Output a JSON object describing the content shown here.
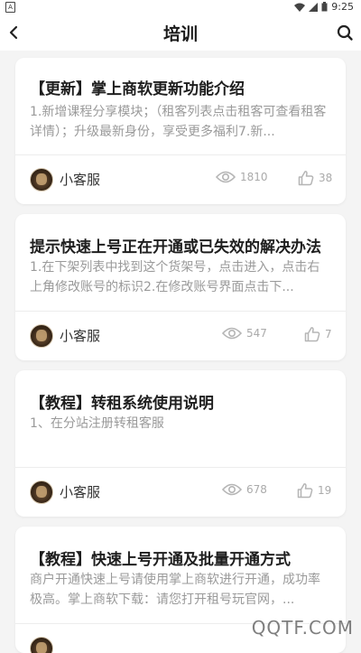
{
  "status_bar": {
    "left_glyph": "A",
    "time": "9:25"
  },
  "header": {
    "title": "培训"
  },
  "articles": [
    {
      "title": "【更新】掌上商软更新功能介绍",
      "desc": "1.新增课程分享模块；（租客列表点击租客可查看租客详情）；升级最新身份，享受更多福利7.新...",
      "author": "小客服",
      "views": "1810",
      "likes": "38"
    },
    {
      "title": "提示快速上号正在开通或已失效的解决办法",
      "desc": "1.在下架列表中找到这个货架号，点击进入，点击右上角修改账号的标识2.在修改账号界面点击下...",
      "author": "小客服",
      "views": "547",
      "likes": "7"
    },
    {
      "title": "【教程】转租系统使用说明",
      "desc": "1、在分站注册转租客服",
      "author": "小客服",
      "views": "678",
      "likes": "19"
    },
    {
      "title": "【教程】快速上号开通及批量开通方式",
      "desc": "商户开通快速上号请使用掌上商软进行开通，成功率极高。掌上商软下载：请您打开租号玩官网，...",
      "author": "",
      "views": "",
      "likes": ""
    }
  ],
  "watermark": "QQTF.COM",
  "icons": {
    "back": "chevron-left-icon",
    "search": "search-icon",
    "views": "eye-icon",
    "likes": "thumbs-up-icon"
  }
}
